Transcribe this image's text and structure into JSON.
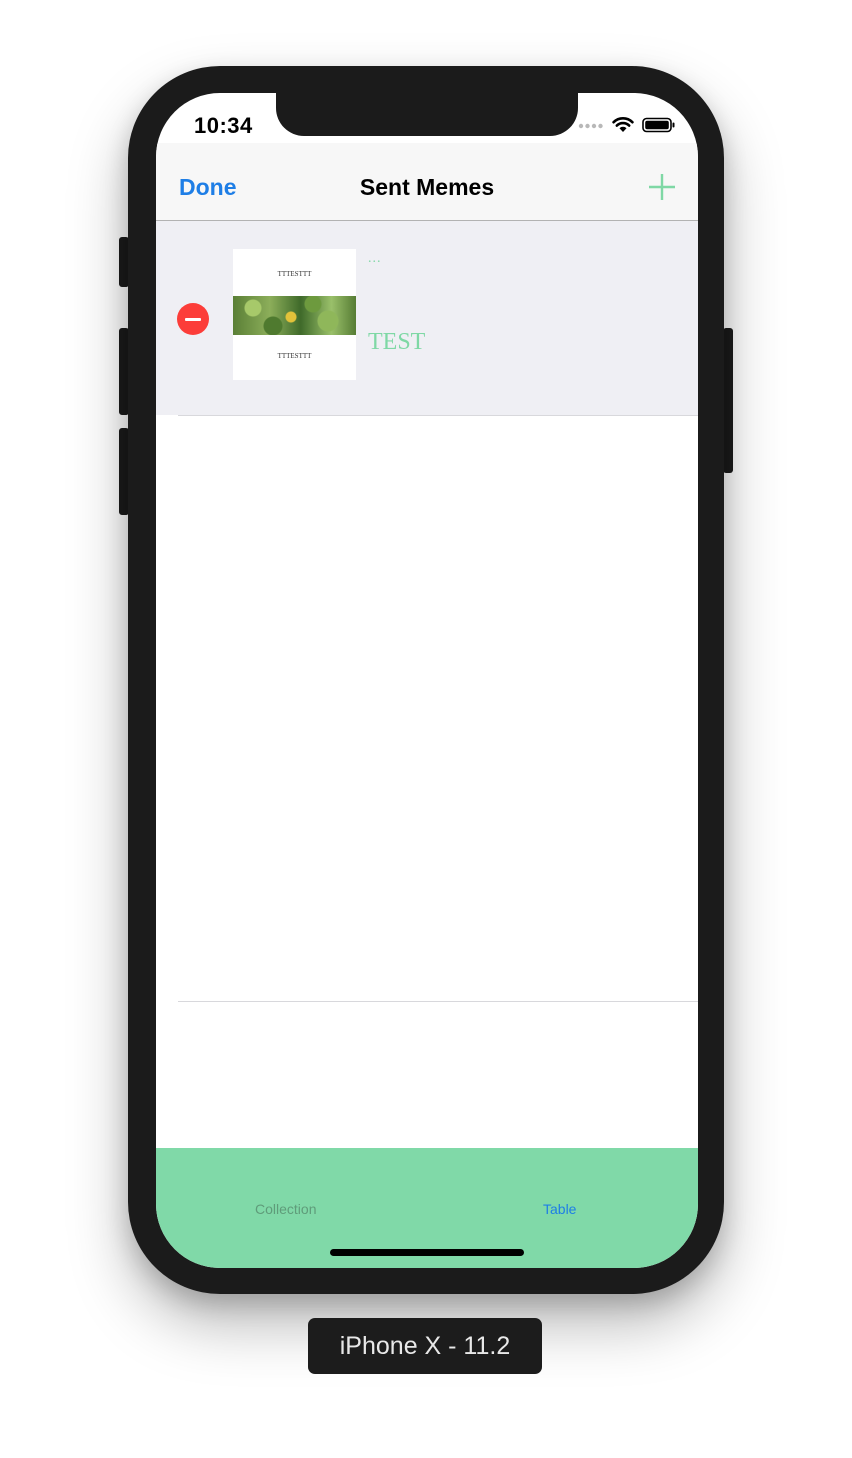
{
  "status_bar": {
    "time": "10:34"
  },
  "navbar": {
    "left_button": "Done",
    "title": "Sent Memes",
    "add_icon": "plus-icon"
  },
  "table": {
    "rows": [
      {
        "top_text": "...",
        "bottom_text": "TEST",
        "thumbnail": {
          "top_caption": "TTTESTTT",
          "bottom_caption": "TTTESTTT"
        }
      }
    ]
  },
  "tabbar": {
    "tabs": [
      {
        "label": "Collection",
        "selected": false
      },
      {
        "label": "Table",
        "selected": true
      }
    ]
  },
  "device_label": "iPhone X - 11.2",
  "colors": {
    "accent_blue": "#1e7ee6",
    "accent_green": "#7fd8a5",
    "tabbar_bg": "#80d9a8",
    "delete_red": "#fc3d39"
  }
}
